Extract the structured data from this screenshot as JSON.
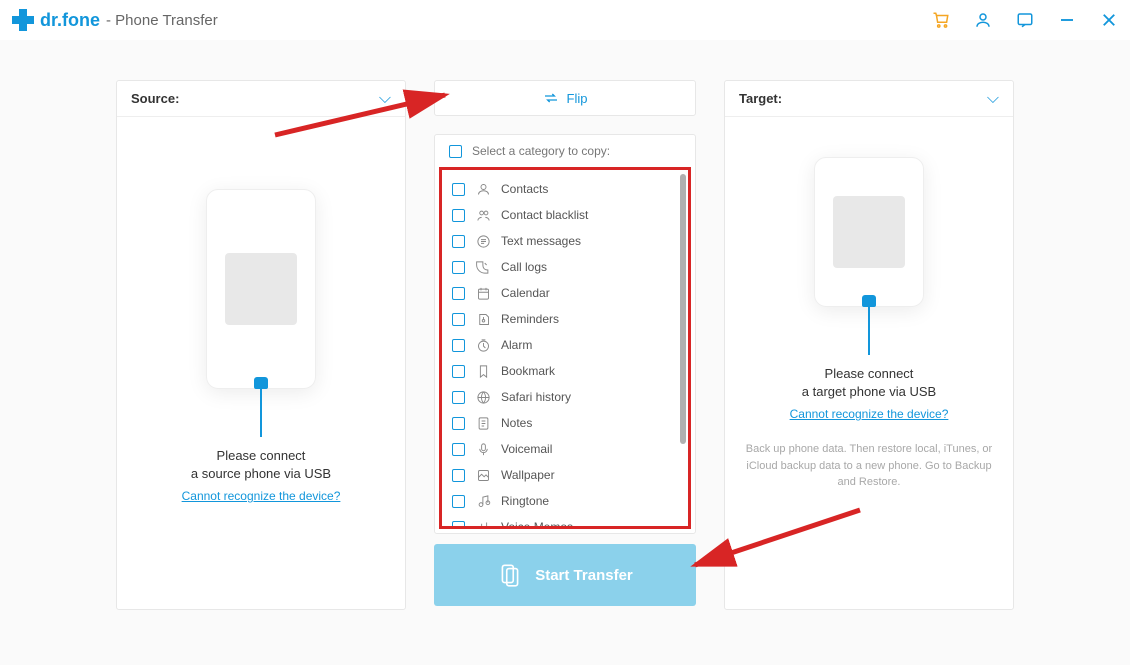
{
  "header": {
    "brand": "dr.fone",
    "subtitle": "- Phone Transfer"
  },
  "source": {
    "label": "Source:",
    "connect_line1": "Please connect",
    "connect_line2": "a source phone via USB",
    "help_link": "Cannot recognize the device?"
  },
  "target": {
    "label": "Target:",
    "connect_line1": "Please connect",
    "connect_line2": "a target phone via USB",
    "help_link": "Cannot recognize the device?",
    "backup_hint": "Back up phone data. Then restore local, iTunes, or iCloud backup data to a new phone. Go to Backup and Restore."
  },
  "center": {
    "flip_label": "Flip",
    "select_header": "Select a category to copy:",
    "categories": [
      "Contacts",
      "Contact blacklist",
      "Text messages",
      "Call logs",
      "Calendar",
      "Reminders",
      "Alarm",
      "Bookmark",
      "Safari history",
      "Notes",
      "Voicemail",
      "Wallpaper",
      "Ringtone",
      "Voice Memos"
    ],
    "start_label": "Start Transfer"
  }
}
